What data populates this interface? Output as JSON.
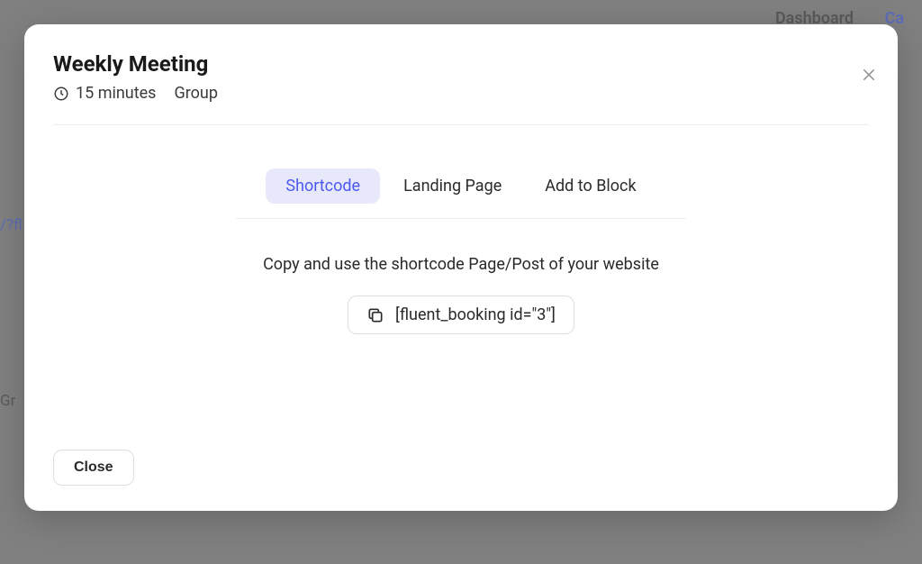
{
  "background": {
    "nav1": "Dashboard",
    "nav2": "Ca",
    "left1": "/?fl",
    "left2": "Gr"
  },
  "modal": {
    "title": "Weekly Meeting",
    "duration": "15 minutes",
    "type": "Group",
    "tabs": {
      "shortcode": "Shortcode",
      "landing": "Landing Page",
      "block": "Add to Block"
    },
    "instruction": "Copy and use the shortcode Page/Post of your website",
    "shortcode_value": "[fluent_booking id=\"3\"]",
    "close_label": "Close"
  }
}
